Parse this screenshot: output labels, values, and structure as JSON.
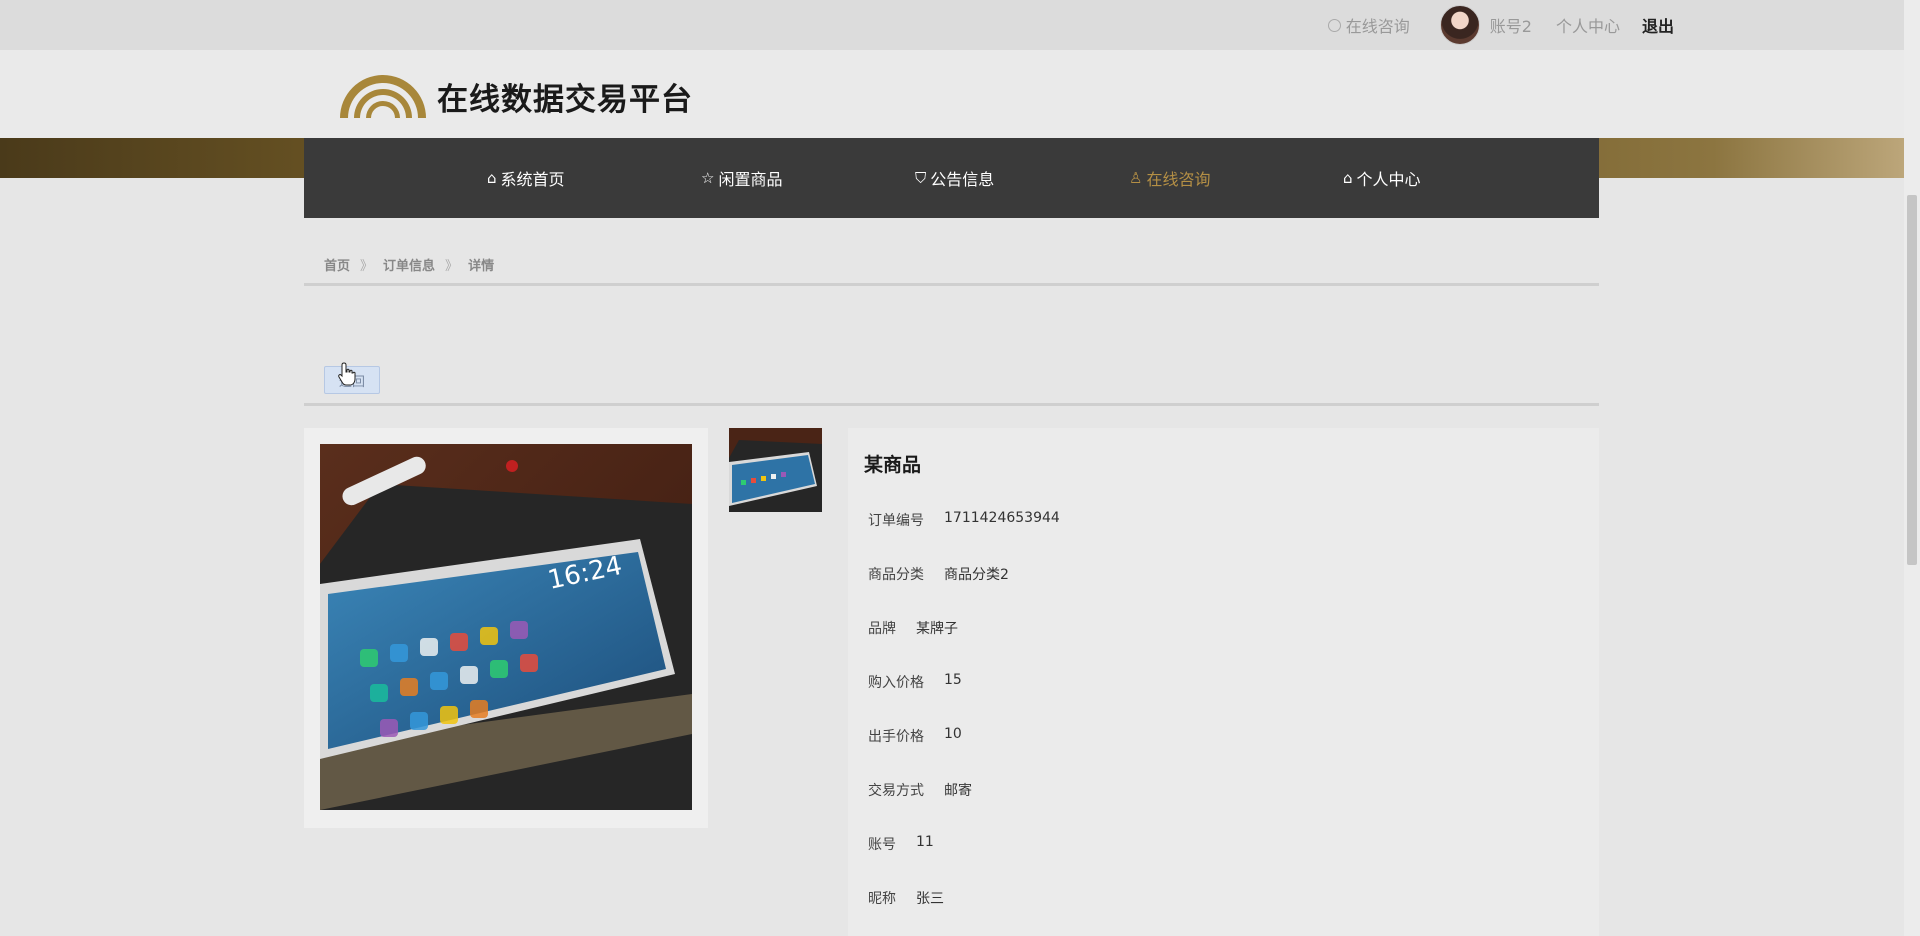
{
  "topbar": {
    "consult": "在线咨询",
    "username": "账号2",
    "center": "个人中心",
    "logout": "退出"
  },
  "header": {
    "site_title": "在线数据交易平台"
  },
  "nav": {
    "items": [
      {
        "label": "系统首页",
        "icon": "home-icon"
      },
      {
        "label": "闲置商品",
        "icon": "star-icon"
      },
      {
        "label": "公告信息",
        "icon": "bag-icon"
      },
      {
        "label": "在线咨询",
        "icon": "user-icon",
        "active": true
      },
      {
        "label": "个人中心",
        "icon": "home-icon"
      }
    ],
    "active_color": "#b48f45"
  },
  "breadcrumb": {
    "home": "首页",
    "orders": "订单信息",
    "detail": "详情"
  },
  "toolbar": {
    "back_label": "返回"
  },
  "product": {
    "name": "某商品",
    "fields": [
      {
        "label": "订单编号",
        "value": "1711424653944"
      },
      {
        "label": "商品分类",
        "value": "商品分类2"
      },
      {
        "label": "品牌",
        "value": "某牌子"
      },
      {
        "label": "购入价格",
        "value": "15"
      },
      {
        "label": "出手价格",
        "value": "10"
      },
      {
        "label": "交易方式",
        "value": "邮寄"
      },
      {
        "label": "账号",
        "value": "11"
      },
      {
        "label": "昵称",
        "value": "张三"
      }
    ]
  }
}
